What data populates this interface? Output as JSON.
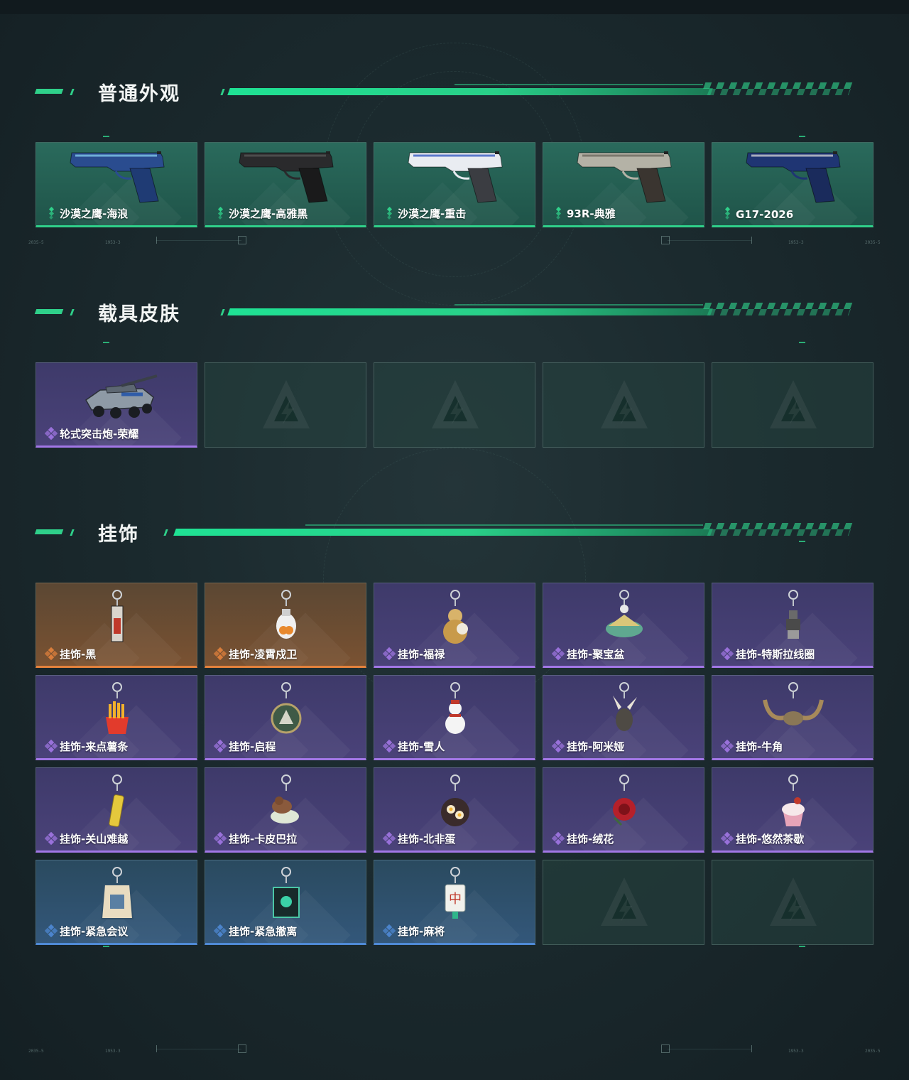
{
  "colors": {
    "accent_green": "#2fd08a",
    "rarity_green": "#2fd08a",
    "rarity_purple": "#a277e6",
    "rarity_orange": "#e4823c",
    "rarity_blue": "#4f8ad6"
  },
  "sections": {
    "weapon_skins": {
      "title": "普通外观",
      "items": [
        {
          "name": "沙漠之鹰-海浪",
          "rarity": "green",
          "icon": "pistol-deagle-blue-icon"
        },
        {
          "name": "沙漠之鹰-高雅黑",
          "rarity": "green",
          "icon": "pistol-deagle-black-icon"
        },
        {
          "name": "沙漠之鹰-重击",
          "rarity": "green",
          "icon": "pistol-deagle-white-icon"
        },
        {
          "name": "93R-典雅",
          "rarity": "green",
          "icon": "pistol-93r-icon"
        },
        {
          "name": "G17-2026",
          "rarity": "green",
          "icon": "pistol-g17-icon"
        }
      ]
    },
    "vehicle_skins": {
      "title": "载具皮肤",
      "items": [
        {
          "name": "轮式突击炮-荣耀",
          "rarity": "purple",
          "icon": "armored-vehicle-icon"
        }
      ],
      "empty_slots": 4
    },
    "charms": {
      "title": "挂饰",
      "items": [
        {
          "name": "挂饰-黑",
          "rarity": "orange",
          "icon": "charm-tag-icon"
        },
        {
          "name": "挂饰-凌霄戍卫",
          "rarity": "orange",
          "icon": "charm-guard-icon"
        },
        {
          "name": "挂饰-福禄",
          "rarity": "purple",
          "icon": "charm-gourd-icon"
        },
        {
          "name": "挂饰-聚宝盆",
          "rarity": "purple",
          "icon": "charm-treasure-bowl-icon"
        },
        {
          "name": "挂饰-特斯拉线圈",
          "rarity": "purple",
          "icon": "charm-tesla-coil-icon"
        },
        {
          "name": "挂饰-来点薯条",
          "rarity": "purple",
          "icon": "charm-fries-icon"
        },
        {
          "name": "挂饰-启程",
          "rarity": "purple",
          "icon": "charm-medal-icon"
        },
        {
          "name": "挂饰-雪人",
          "rarity": "purple",
          "icon": "charm-snowman-icon"
        },
        {
          "name": "挂饰-阿米娅",
          "rarity": "purple",
          "icon": "charm-rabbit-icon"
        },
        {
          "name": "挂饰-牛角",
          "rarity": "purple",
          "icon": "charm-horns-icon"
        },
        {
          "name": "挂饰-关山难越",
          "rarity": "purple",
          "icon": "charm-gold-bar-icon"
        },
        {
          "name": "挂饰-卡皮巴拉",
          "rarity": "purple",
          "icon": "charm-capybara-icon"
        },
        {
          "name": "挂饰-北非蛋",
          "rarity": "purple",
          "icon": "charm-shakshuka-icon"
        },
        {
          "name": "挂饰-绒花",
          "rarity": "purple",
          "icon": "charm-flower-icon"
        },
        {
          "name": "挂饰-悠然茶歇",
          "rarity": "purple",
          "icon": "charm-cupcake-icon"
        },
        {
          "name": "挂饰-紧急会议",
          "rarity": "blue",
          "icon": "charm-meeting-icon"
        },
        {
          "name": "挂饰-紧急撤离",
          "rarity": "blue",
          "icon": "charm-evac-icon"
        },
        {
          "name": "挂饰-麻将",
          "rarity": "blue",
          "icon": "charm-mahjong-icon"
        }
      ],
      "empty_slots": 2
    }
  }
}
